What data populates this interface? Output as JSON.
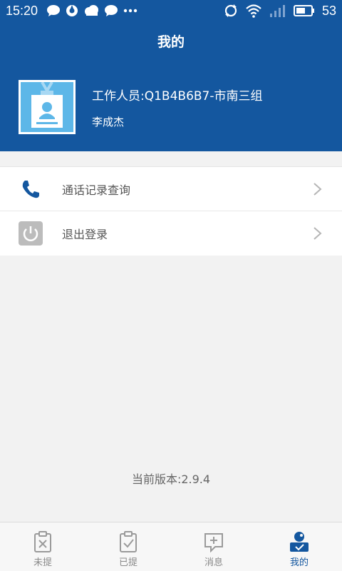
{
  "status_bar": {
    "time": "15:20",
    "battery": "53",
    "left_icons": [
      "chat-bubble-icon",
      "camera-app-icon",
      "cloud-icon",
      "chat-bubble-icon",
      "more-dots-icon"
    ],
    "right_icons": [
      "sync-icon",
      "wifi-icon",
      "signal-icon",
      "battery-icon"
    ]
  },
  "header": {
    "title": "我的"
  },
  "profile": {
    "worker_line": "工作人员:Q1B4B6B7-市南三组",
    "name": "李成杰",
    "avatar_icon": "id-badge-icon"
  },
  "menu": {
    "items": [
      {
        "label": "通话记录查询",
        "icon": "phone-icon"
      },
      {
        "label": "退出登录",
        "icon": "power-icon"
      }
    ]
  },
  "footer": {
    "version": "当前版本:2.9.4"
  },
  "bottom_nav": {
    "tabs": [
      {
        "label": "未提",
        "icon": "clipboard-x-icon",
        "active": false
      },
      {
        "label": "已提",
        "icon": "clipboard-check-icon",
        "active": false
      },
      {
        "label": "消息",
        "icon": "message-plus-icon",
        "active": false
      },
      {
        "label": "我的",
        "icon": "profile-check-icon",
        "active": true
      }
    ]
  },
  "colors": {
    "primary": "#14579f",
    "background": "#f2f2f2",
    "active_tab": "#14579f",
    "inactive_tab": "#8a8a8a"
  }
}
